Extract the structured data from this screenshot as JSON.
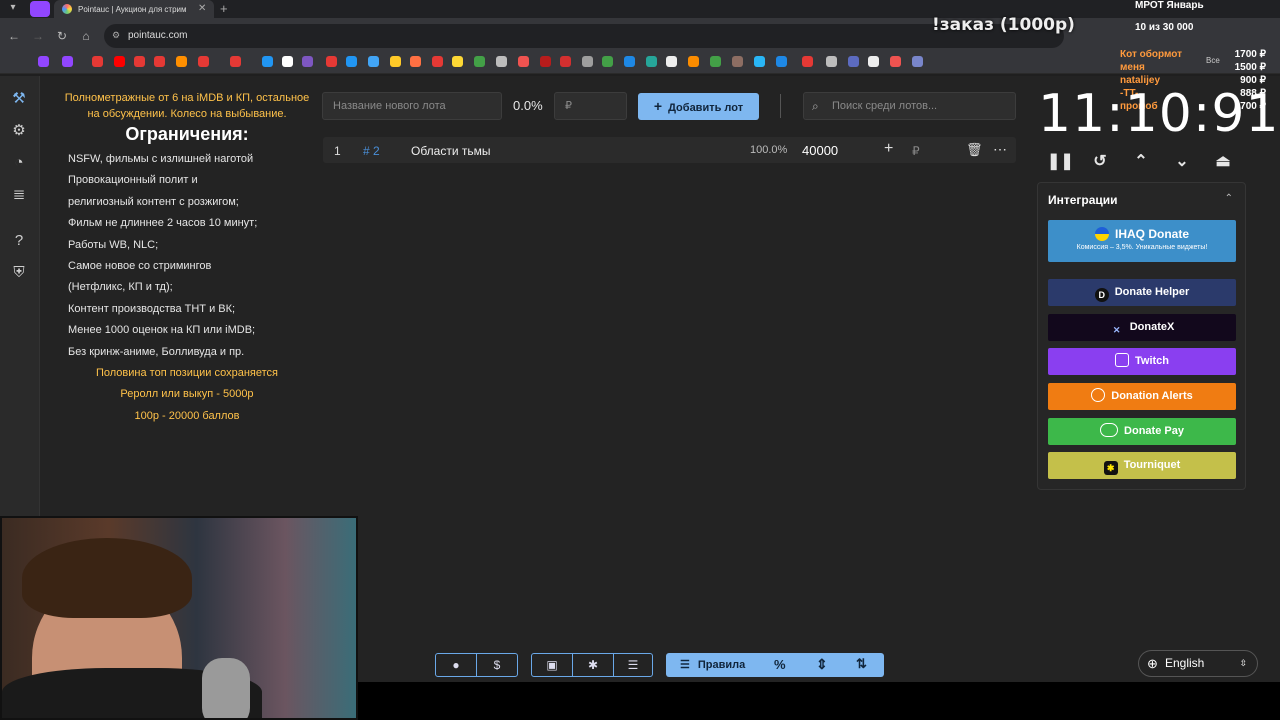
{
  "browser": {
    "tab_title": "Pointauc | Аукцион для стрим",
    "url": "pointauc.com",
    "new_tab_symbol": "+",
    "bookmarks_all_label": "Все"
  },
  "overlay": {
    "order_text": "!заказ (1000р)",
    "mrot_label": "МРОТ Январь",
    "progress_text": "10  из 30 000",
    "donors": [
      "Кот обормот",
      "меня",
      "natalijey",
      "-TT-",
      "промоб"
    ],
    "amounts": [
      "1700 ₽",
      "1500 ₽",
      "900 ₽",
      "888 ₽",
      "700 ₽"
    ]
  },
  "rules": {
    "intro": "Полнометражные от 6 на iMDB и КП, остальное на обсуждении. Колесо на выбывание.",
    "title": "Ограничения:",
    "lines": [
      "NSFW, фильмы с излишней наготой",
      "Провокационный полит и",
      "религиозный контент с розжигом;",
      "Фильм не длиннее 2 часов 10 минут;",
      "Работы WB, NLC;",
      "Самое новое со стримингов",
      "(Нетфликс, КП и тд);",
      "Контент производства ТНТ и ВК;",
      "Менее 1000 оценок на КП или iMDB;",
      "Без кринж-аниме, Болливуда и пр."
    ],
    "notes": [
      "Половина топ позиции сохраняется",
      "Реролл или выкуп - 5000р",
      "100р - 20000 баллов"
    ]
  },
  "controls": {
    "lot_name_placeholder": "Название нового лота",
    "percent": "0.0%",
    "amount_placeholder": "₽",
    "add_lot_label": "Добавить лот",
    "search_placeholder": "Поиск среди лотов..."
  },
  "lots": [
    {
      "index": "1",
      "id": "# 2",
      "name": "Области тьмы",
      "percent": "100.0%",
      "amount": "40000",
      "currency": "₽"
    }
  ],
  "timer": {
    "value": "11:10:91"
  },
  "integrations": {
    "title": "Интеграции",
    "ihaq": {
      "label": "IHAQ Donate",
      "sub": "Комиссия – 3,5%. Уникальные виджеты!"
    },
    "buttons": [
      {
        "label": "Donate Helper",
        "color": "#2b3a6b"
      },
      {
        "label": "DonateX",
        "color": "#12081c"
      },
      {
        "label": "Twitch",
        "color": "#8a3ff0"
      },
      {
        "label": "Donation Alerts",
        "color": "#f07c12"
      },
      {
        "label": "Donate Pay",
        "color": "#3db84a"
      },
      {
        "label": "Tourniquet",
        "color": "#c4c04a"
      }
    ]
  },
  "toolbar": {
    "rules_label": "Правила",
    "percent_icon": "%",
    "language": "English"
  }
}
